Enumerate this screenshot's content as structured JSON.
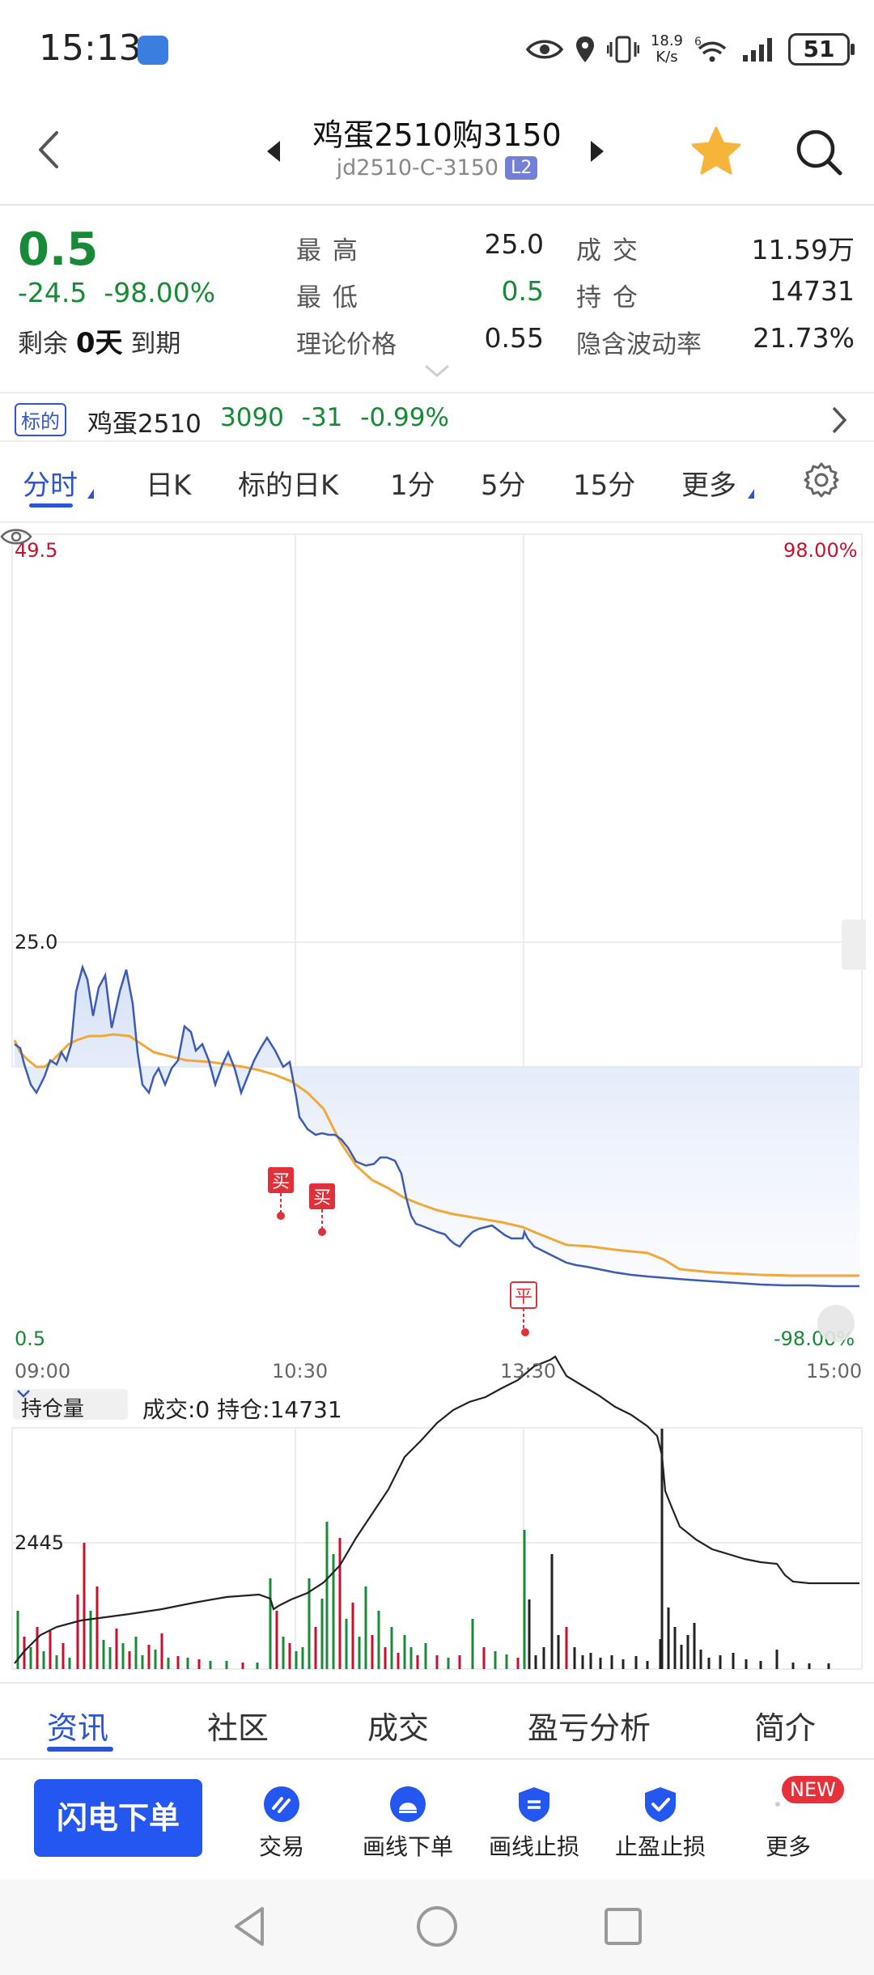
{
  "status_bar": {
    "time": "15:13",
    "net_speed_top": "18.9",
    "net_speed_unit": "K/s",
    "signal_label": "6",
    "battery": "51",
    "icons": [
      "eye-icon",
      "location-icon",
      "vibrate-icon",
      "wifi-icon",
      "cell-signal-icon",
      "battery-icon"
    ]
  },
  "header": {
    "title": "鸡蛋2510购3150",
    "code": "jd2510-C-3150",
    "level_badge": "L2"
  },
  "quote": {
    "price": "0.5",
    "change": "-24.5",
    "change_pct": "-98.00%",
    "remain_label": "剩余",
    "remain_days": "0天",
    "remain_suffix": "到期",
    "high_label": "最 高",
    "high_value": "25.0",
    "low_label": "最 低",
    "low_value": "0.5",
    "theory_label": "理论价格",
    "theory_value": "0.55",
    "volume_label": "成 交",
    "volume_value": "11.59万",
    "oi_label": "持 仓",
    "oi_value": "14731",
    "iv_label": "隐含波动率",
    "iv_value": "21.73%"
  },
  "underlying": {
    "tag": "标的",
    "name": "鸡蛋2510",
    "price": "3090",
    "change": "-31",
    "change_pct": "-0.99%"
  },
  "tabs": [
    {
      "label": "分时",
      "active": true
    },
    {
      "label": "日K"
    },
    {
      "label": "标的日K"
    },
    {
      "label": "1分"
    },
    {
      "label": "5分"
    },
    {
      "label": "15分"
    },
    {
      "label": "更多"
    }
  ],
  "chart": {
    "y_top_label": "49.5",
    "y_mid_label": "25.0",
    "y_bottom_label": "0.5",
    "pct_top_label": "98.00%",
    "pct_bottom_label": "-98.00%",
    "time_labels": [
      "09:00",
      "10:30",
      "13:30",
      "15:00"
    ],
    "markers": [
      {
        "label": "买",
        "kind": "buy"
      },
      {
        "label": "买",
        "kind": "buy"
      },
      {
        "label": "平",
        "kind": "close"
      }
    ],
    "volume_selector": "持仓量",
    "volume_info": "成交:0  持仓:14731",
    "volume_y_label": "2445",
    "colors": {
      "price_line": "#3c5bb6",
      "avg_line": "#f0a838",
      "up": "#c8102e",
      "down": "#1a8a3a"
    }
  },
  "chart_data": {
    "type": "line",
    "x": [
      "09:00",
      "10:30",
      "13:30",
      "15:00"
    ],
    "ylim": [
      0.5,
      49.5
    ],
    "series": []
  },
  "bottom_tabs": [
    {
      "label": "资讯",
      "active": true
    },
    {
      "label": "社区"
    },
    {
      "label": "成交"
    },
    {
      "label": "盈亏分析"
    },
    {
      "label": "简介"
    }
  ],
  "actions": {
    "flash_order": "闪电下单",
    "trade": "交易",
    "line_order": "画线下单",
    "line_stop": "画线止损",
    "tp_sl": "止盈止损",
    "more": "更多",
    "new_badge": "NEW"
  }
}
